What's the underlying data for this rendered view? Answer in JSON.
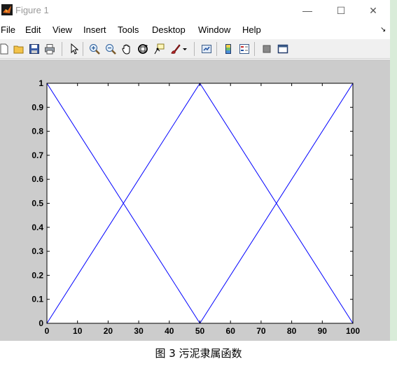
{
  "window": {
    "title": "Figure 1",
    "controls": {
      "minimize": "—",
      "maximize": "☐",
      "close": "✕"
    }
  },
  "menubar": {
    "items": [
      "File",
      "Edit",
      "View",
      "Insert",
      "Tools",
      "Desktop",
      "Window",
      "Help"
    ],
    "overflow": "↘"
  },
  "toolbar": {
    "buttons": [
      "new-figure-icon",
      "open-file-icon",
      "save-icon",
      "print-icon",
      "edit-plot-arrow-icon",
      "zoom-in-icon",
      "zoom-out-icon",
      "pan-hand-icon",
      "rotate-3d-icon",
      "data-cursor-icon",
      "brush-icon",
      "link-plot-icon",
      "colorbar-icon",
      "legend-icon",
      "hide-plot-tools-icon",
      "show-plot-tools-icon"
    ]
  },
  "chart_data": {
    "type": "line",
    "title": "",
    "xlabel": "",
    "ylabel": "",
    "xlim": [
      0,
      100
    ],
    "ylim": [
      0,
      1
    ],
    "xticks": [
      "0",
      "10",
      "20",
      "30",
      "40",
      "50",
      "60",
      "70",
      "80",
      "90",
      "100"
    ],
    "yticks": [
      "0",
      "0.1",
      "0.2",
      "0.3",
      "0.4",
      "0.5",
      "0.6",
      "0.7",
      "0.8",
      "0.9",
      "1"
    ],
    "grid": false,
    "series": [
      {
        "x": [
          0,
          50
        ],
        "y": [
          1,
          0
        ]
      },
      {
        "x": [
          0,
          50,
          100
        ],
        "y": [
          0,
          1,
          0
        ]
      },
      {
        "x": [
          50,
          100
        ],
        "y": [
          0,
          1
        ]
      }
    ],
    "line_color": "#0000ff"
  },
  "caption": "图 3  污泥隶属函数"
}
